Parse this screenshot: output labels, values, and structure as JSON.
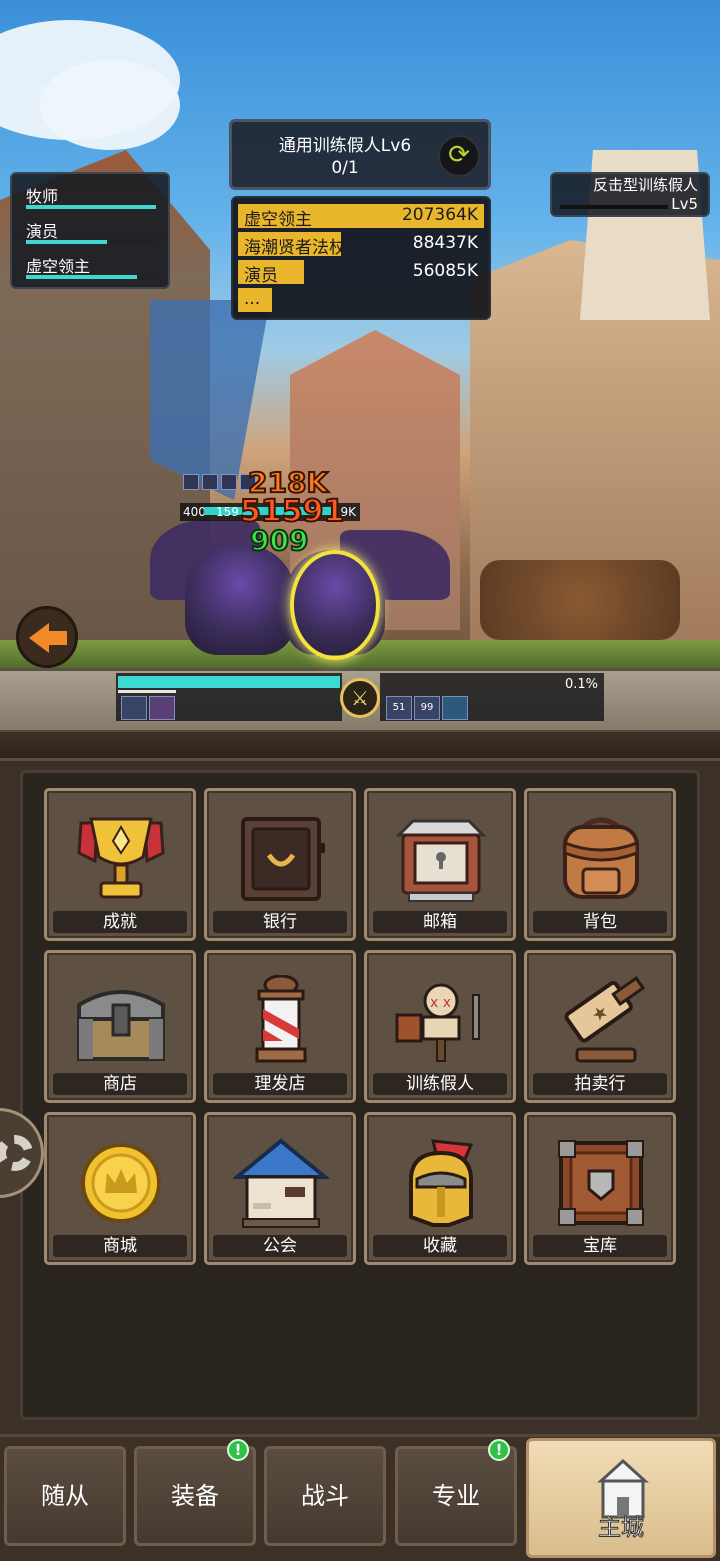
{
  "party": {
    "heroes": [
      {
        "name": "牧师",
        "hp": 1.0
      },
      {
        "name": "演员",
        "hp": 0.62
      },
      {
        "name": "虚空领主",
        "hp": 0.85
      }
    ]
  },
  "target": {
    "name": "通用训练假人Lv6",
    "progress": "0/1"
  },
  "damage_meter": {
    "rows": [
      {
        "name": "虚空领主",
        "value": "207364K",
        "share": 1.0
      },
      {
        "name": "海潮贤者法杖",
        "value": "88437K",
        "share": 0.42
      },
      {
        "name": "演员",
        "value": "56085K",
        "share": 0.27
      }
    ],
    "more": "..."
  },
  "enemy": {
    "name": "反击型训练假人",
    "level": "Lv5"
  },
  "combat": {
    "floating_numbers": [
      "218K",
      "51591",
      "909"
    ],
    "mini_hp_level": "400",
    "mini_hp_left": "159",
    "mini_hp_right": "9K",
    "team_hp": 0.99,
    "enemy_hp_percent": "0.1%",
    "enemy_buff_counts": [
      "51",
      "99"
    ]
  },
  "menu": {
    "items": [
      {
        "label": "成就",
        "icon": "trophy-icon"
      },
      {
        "label": "银行",
        "icon": "safe-icon"
      },
      {
        "label": "邮箱",
        "icon": "mailbox-icon"
      },
      {
        "label": "背包",
        "icon": "backpack-icon"
      },
      {
        "label": "商店",
        "icon": "chest-icon"
      },
      {
        "label": "理发店",
        "icon": "barber-pole-icon"
      },
      {
        "label": "训练假人",
        "icon": "training-dummy-icon"
      },
      {
        "label": "拍卖行",
        "icon": "gavel-icon"
      },
      {
        "label": "商城",
        "icon": "gold-coin-icon"
      },
      {
        "label": "公会",
        "icon": "guild-house-icon"
      },
      {
        "label": "收藏",
        "icon": "helmet-icon"
      },
      {
        "label": "宝库",
        "icon": "vault-crate-icon"
      }
    ]
  },
  "tabs": [
    {
      "label": "随从",
      "badge": false
    },
    {
      "label": "装备",
      "badge": true
    },
    {
      "label": "战斗",
      "badge": false
    },
    {
      "label": "专业",
      "badge": true
    },
    {
      "label": "主城",
      "badge": false,
      "active": true
    }
  ],
  "badge_text": "!",
  "colors": {
    "hp_bar": "#41d6d1",
    "damage_bar": "#e9b52b",
    "badge": "#32c04a"
  }
}
